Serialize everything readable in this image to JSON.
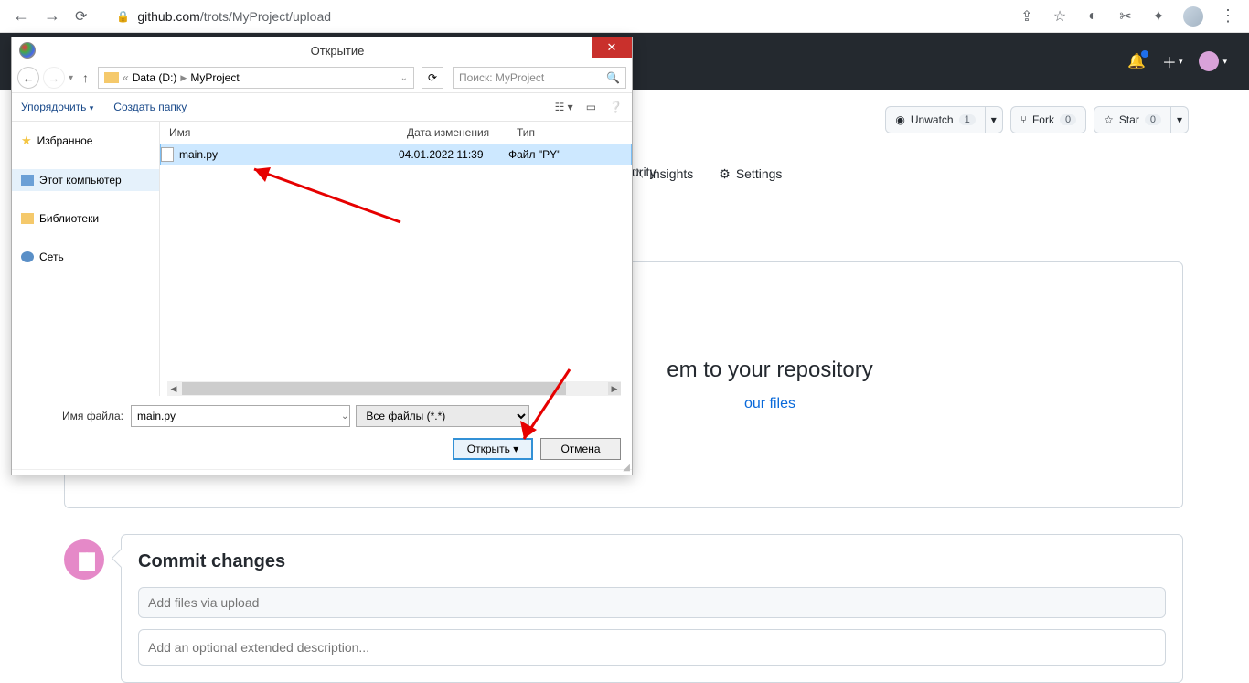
{
  "browser": {
    "url_prefix": "github.com",
    "url_rest": "/trots/MyProject/upload"
  },
  "github": {
    "unwatch_label": "Unwatch",
    "unwatch_count": "1",
    "fork_label": "Fork",
    "fork_count": "0",
    "star_label": "Star",
    "star_count": "0",
    "tab_security_partial": "curity",
    "tab_insights": "Insights",
    "tab_settings": "Settings",
    "drop_title_partial": "em to your repository",
    "drop_sub_partial": "our files",
    "commit_title": "Commit changes",
    "commit_summary_placeholder": "Add files via upload",
    "commit_desc_placeholder": "Add an optional extended description..."
  },
  "dialog": {
    "title": "Открытие",
    "path_root": "Data (D:)",
    "path_folder": "MyProject",
    "search_placeholder": "Поиск: MyProject",
    "organize": "Упорядочить",
    "new_folder": "Создать папку",
    "sidebar": {
      "favorites": "Избранное",
      "computer": "Этот компьютер",
      "libraries": "Библиотеки",
      "network": "Сеть"
    },
    "columns": {
      "name": "Имя",
      "date": "Дата изменения",
      "type": "Тип"
    },
    "file": {
      "name": "main.py",
      "date": "04.01.2022 11:39",
      "type": "Файл \"PY\""
    },
    "filename_label": "Имя файла:",
    "filename_value": "main.py",
    "filter": "Все файлы (*.*)",
    "open": "Открыть",
    "cancel": "Отмена"
  }
}
